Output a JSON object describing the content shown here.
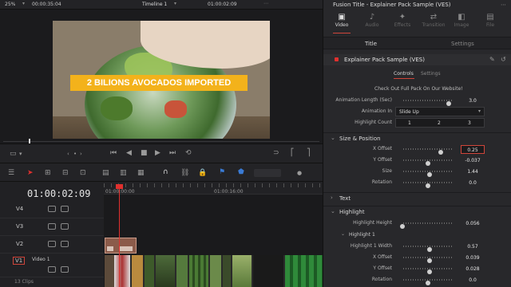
{
  "topbar": {
    "zoom": "25%",
    "timecode_left": "00:00:35:04",
    "timeline_name": "Timeline 1",
    "timecode_right": "01:00:02:09"
  },
  "viewer": {
    "title_text": "2 BILIONS AVOCADOS IMPORTED"
  },
  "timeline": {
    "timecode": "01:00:02:09",
    "ruler": [
      "01:00:00:00",
      "01:00:16:00"
    ],
    "tracks": [
      {
        "id": "V4",
        "name": ""
      },
      {
        "id": "V3",
        "name": ""
      },
      {
        "id": "V2",
        "name": ""
      },
      {
        "id": "V1",
        "name": "Video 1"
      }
    ],
    "clip_count": "13 Clips"
  },
  "inspector": {
    "title": "Fusion Title - Explainer Pack Sample (VES)",
    "tabs": [
      "Video",
      "Audio",
      "Effects",
      "Transition",
      "Image",
      "File"
    ],
    "subtabs": [
      "Title",
      "Settings"
    ],
    "effect_name": "Explainer Pack Sample (VES)",
    "controls_tabs": [
      "Controls",
      "Settings"
    ],
    "promo": "Check Out Full Pack On Our Website!",
    "animation_length": {
      "label": "Animation Length (Sec)",
      "value": "3.0"
    },
    "animation_in": {
      "label": "Animation In",
      "value": "Slide Up"
    },
    "highlight_count": {
      "label": "Highlight Count",
      "options": [
        "1",
        "2",
        "3"
      ]
    },
    "size_position": {
      "header": "Size & Position",
      "x_offset": {
        "label": "X Offset",
        "value": "0.25"
      },
      "y_offset": {
        "label": "Y Offset",
        "value": "-0.037"
      },
      "size": {
        "label": "Size",
        "value": "1.44"
      },
      "rotation": {
        "label": "Rotation",
        "value": "0.0"
      }
    },
    "text_header": "Text",
    "highlight": {
      "header": "Highlight",
      "height": {
        "label": "Highlight Height",
        "value": "0.056"
      },
      "sub_header": "Highlight 1",
      "width": {
        "label": "Highlight 1 Width",
        "value": "0.57"
      },
      "x_offset": {
        "label": "X Offset",
        "value": "0.039"
      },
      "y_offset": {
        "label": "Y Offset",
        "value": "0.028"
      },
      "rotation": {
        "label": "Rotation",
        "value": "0.0"
      }
    }
  },
  "colors": {
    "accent_red": "#e0302e",
    "banner": "#f3b21b",
    "playhead": "#e0302e"
  }
}
